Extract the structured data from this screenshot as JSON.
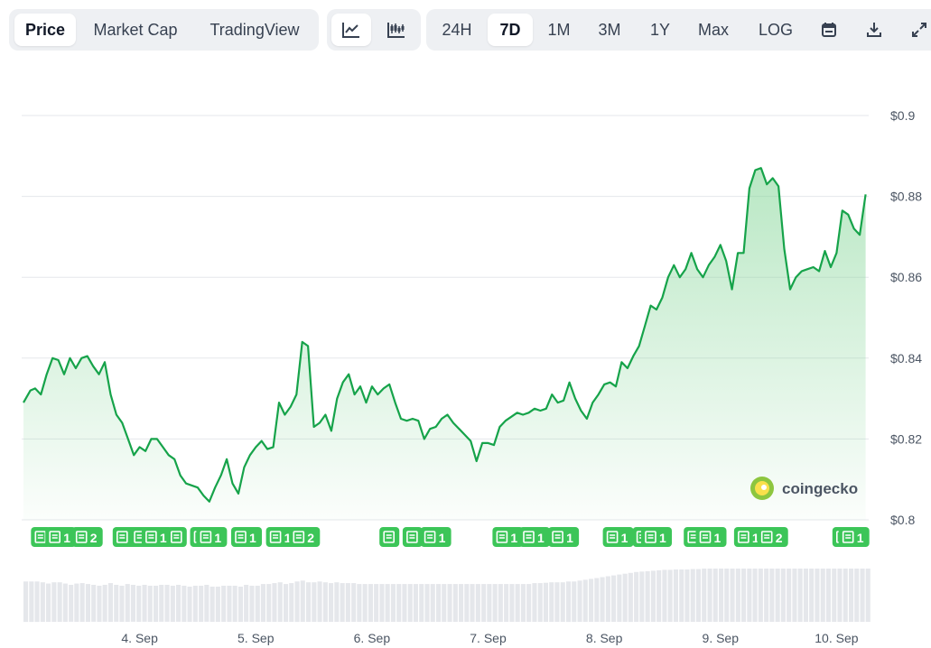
{
  "toolbar": {
    "metric_tabs": [
      {
        "label": "Price",
        "active": true
      },
      {
        "label": "Market Cap",
        "active": false
      },
      {
        "label": "TradingView",
        "active": false
      }
    ],
    "chart_style": [
      {
        "icon": "line-chart-icon",
        "active": true
      },
      {
        "icon": "candlestick-icon",
        "active": false
      }
    ],
    "ranges": [
      {
        "label": "24H",
        "active": false
      },
      {
        "label": "7D",
        "active": true
      },
      {
        "label": "1M",
        "active": false
      },
      {
        "label": "3M",
        "active": false
      },
      {
        "label": "1Y",
        "active": false
      },
      {
        "label": "Max",
        "active": false
      },
      {
        "label": "LOG",
        "active": false
      }
    ],
    "tools": [
      "calendar-icon",
      "download-icon",
      "expand-icon"
    ]
  },
  "watermark": "coingecko",
  "colors": {
    "line": "#16a34a",
    "area_top": "#bfe8c9",
    "badge": "#3cc558",
    "volume": "#e5e7eb",
    "grid": "#e5e7eb"
  },
  "chart_data": {
    "type": "area",
    "ylim": [
      0.8,
      0.9
    ],
    "yticks": [
      "$0.9",
      "$0.88",
      "$0.86",
      "$0.84",
      "$0.82",
      "$0.8"
    ],
    "ytick_values": [
      0.9,
      0.88,
      0.86,
      0.84,
      0.82,
      0.8
    ],
    "xlabels": [
      "4. Sep",
      "5. Sep",
      "6. Sep",
      "7. Sep",
      "8. Sep",
      "9. Sep",
      "10. Sep"
    ],
    "xlabel_days": [
      1,
      2,
      3,
      4,
      5,
      6,
      7
    ],
    "x_range_days": [
      0,
      7.3
    ],
    "price": [
      [
        0.0,
        0.829
      ],
      [
        0.06,
        0.832
      ],
      [
        0.1,
        0.8325
      ],
      [
        0.15,
        0.831
      ],
      [
        0.2,
        0.836
      ],
      [
        0.25,
        0.84
      ],
      [
        0.3,
        0.8395
      ],
      [
        0.35,
        0.836
      ],
      [
        0.4,
        0.84
      ],
      [
        0.45,
        0.8375
      ],
      [
        0.5,
        0.84
      ],
      [
        0.55,
        0.8405
      ],
      [
        0.6,
        0.838
      ],
      [
        0.65,
        0.836
      ],
      [
        0.7,
        0.839
      ],
      [
        0.75,
        0.831
      ],
      [
        0.8,
        0.826
      ],
      [
        0.85,
        0.824
      ],
      [
        0.9,
        0.82
      ],
      [
        0.95,
        0.816
      ],
      [
        1.0,
        0.818
      ],
      [
        1.05,
        0.817
      ],
      [
        1.1,
        0.82
      ],
      [
        1.15,
        0.82
      ],
      [
        1.2,
        0.818
      ],
      [
        1.25,
        0.816
      ],
      [
        1.3,
        0.815
      ],
      [
        1.35,
        0.811
      ],
      [
        1.4,
        0.809
      ],
      [
        1.45,
        0.8085
      ],
      [
        1.5,
        0.808
      ],
      [
        1.55,
        0.806
      ],
      [
        1.6,
        0.8045
      ],
      [
        1.65,
        0.808
      ],
      [
        1.7,
        0.811
      ],
      [
        1.75,
        0.815
      ],
      [
        1.8,
        0.809
      ],
      [
        1.85,
        0.8065
      ],
      [
        1.9,
        0.813
      ],
      [
        1.95,
        0.816
      ],
      [
        2.0,
        0.818
      ],
      [
        2.05,
        0.8195
      ],
      [
        2.1,
        0.8175
      ],
      [
        2.15,
        0.818
      ],
      [
        2.2,
        0.829
      ],
      [
        2.25,
        0.826
      ],
      [
        2.3,
        0.828
      ],
      [
        2.35,
        0.831
      ],
      [
        2.4,
        0.844
      ],
      [
        2.45,
        0.843
      ],
      [
        2.5,
        0.823
      ],
      [
        2.55,
        0.824
      ],
      [
        2.6,
        0.826
      ],
      [
        2.65,
        0.822
      ],
      [
        2.7,
        0.83
      ],
      [
        2.75,
        0.834
      ],
      [
        2.8,
        0.836
      ],
      [
        2.85,
        0.831
      ],
      [
        2.9,
        0.833
      ],
      [
        2.95,
        0.829
      ],
      [
        3.0,
        0.833
      ],
      [
        3.05,
        0.831
      ],
      [
        3.1,
        0.8325
      ],
      [
        3.15,
        0.8335
      ],
      [
        3.2,
        0.829
      ],
      [
        3.25,
        0.825
      ],
      [
        3.3,
        0.8245
      ],
      [
        3.35,
        0.825
      ],
      [
        3.4,
        0.8245
      ],
      [
        3.45,
        0.82
      ],
      [
        3.5,
        0.8225
      ],
      [
        3.55,
        0.823
      ],
      [
        3.6,
        0.825
      ],
      [
        3.65,
        0.826
      ],
      [
        3.7,
        0.824
      ],
      [
        3.75,
        0.8225
      ],
      [
        3.8,
        0.821
      ],
      [
        3.85,
        0.8195
      ],
      [
        3.9,
        0.8145
      ],
      [
        3.95,
        0.819
      ],
      [
        4.0,
        0.819
      ],
      [
        4.05,
        0.8185
      ],
      [
        4.1,
        0.823
      ],
      [
        4.15,
        0.8245
      ],
      [
        4.2,
        0.8255
      ],
      [
        4.25,
        0.8265
      ],
      [
        4.3,
        0.826
      ],
      [
        4.35,
        0.8265
      ],
      [
        4.4,
        0.8275
      ],
      [
        4.45,
        0.827
      ],
      [
        4.5,
        0.8275
      ],
      [
        4.55,
        0.831
      ],
      [
        4.6,
        0.829
      ],
      [
        4.65,
        0.8295
      ],
      [
        4.7,
        0.834
      ],
      [
        4.75,
        0.83
      ],
      [
        4.8,
        0.827
      ],
      [
        4.85,
        0.825
      ],
      [
        4.9,
        0.829
      ],
      [
        4.95,
        0.831
      ],
      [
        5.0,
        0.8335
      ],
      [
        5.05,
        0.834
      ],
      [
        5.1,
        0.833
      ],
      [
        5.15,
        0.839
      ],
      [
        5.2,
        0.8375
      ],
      [
        5.25,
        0.8405
      ],
      [
        5.3,
        0.843
      ],
      [
        5.35,
        0.848
      ],
      [
        5.4,
        0.853
      ],
      [
        5.45,
        0.852
      ],
      [
        5.5,
        0.855
      ],
      [
        5.55,
        0.86
      ],
      [
        5.6,
        0.863
      ],
      [
        5.65,
        0.86
      ],
      [
        5.7,
        0.862
      ],
      [
        5.75,
        0.866
      ],
      [
        5.8,
        0.862
      ],
      [
        5.85,
        0.86
      ],
      [
        5.9,
        0.863
      ],
      [
        5.95,
        0.865
      ],
      [
        6.0,
        0.868
      ],
      [
        6.05,
        0.864
      ],
      [
        6.1,
        0.857
      ],
      [
        6.15,
        0.866
      ],
      [
        6.2,
        0.866
      ],
      [
        6.25,
        0.882
      ],
      [
        6.3,
        0.8865
      ],
      [
        6.35,
        0.887
      ],
      [
        6.4,
        0.883
      ],
      [
        6.45,
        0.8845
      ],
      [
        6.5,
        0.8825
      ],
      [
        6.55,
        0.867
      ],
      [
        6.6,
        0.857
      ],
      [
        6.65,
        0.86
      ],
      [
        6.7,
        0.8615
      ],
      [
        6.75,
        0.862
      ],
      [
        6.8,
        0.8625
      ],
      [
        6.85,
        0.8615
      ],
      [
        6.9,
        0.8665
      ],
      [
        6.95,
        0.8625
      ],
      [
        7.0,
        0.866
      ],
      [
        7.05,
        0.8765
      ],
      [
        7.1,
        0.8755
      ],
      [
        7.15,
        0.872
      ],
      [
        7.2,
        0.8705
      ],
      [
        7.25,
        0.8805
      ]
    ],
    "volume_relative": [
      0.9,
      0.9,
      0.9,
      0.88,
      0.85,
      0.88,
      0.88,
      0.85,
      0.82,
      0.85,
      0.86,
      0.84,
      0.82,
      0.8,
      0.82,
      0.86,
      0.82,
      0.8,
      0.84,
      0.82,
      0.8,
      0.82,
      0.8,
      0.8,
      0.82,
      0.82,
      0.8,
      0.82,
      0.8,
      0.78,
      0.8,
      0.8,
      0.82,
      0.78,
      0.78,
      0.8,
      0.8,
      0.8,
      0.78,
      0.82,
      0.8,
      0.8,
      0.84,
      0.84,
      0.86,
      0.88,
      0.84,
      0.86,
      0.9,
      0.92,
      0.88,
      0.88,
      0.9,
      0.88,
      0.86,
      0.88,
      0.86,
      0.86,
      0.86,
      0.84,
      0.84,
      0.84,
      0.84,
      0.84,
      0.84,
      0.84,
      0.84,
      0.84,
      0.84,
      0.84,
      0.84,
      0.84,
      0.84,
      0.84,
      0.84,
      0.84,
      0.84,
      0.84,
      0.84,
      0.84,
      0.84,
      0.84,
      0.84,
      0.84,
      0.84,
      0.84,
      0.84,
      0.84,
      0.84,
      0.84,
      0.86,
      0.86,
      0.87,
      0.88,
      0.88,
      0.88,
      0.9,
      0.9,
      0.92,
      0.94,
      0.96,
      0.98,
      1.0,
      1.02,
      1.04,
      1.06,
      1.08,
      1.1,
      1.12,
      1.13,
      1.14,
      1.15,
      1.16,
      1.17,
      1.17,
      1.18,
      1.18,
      1.18,
      1.19,
      1.19,
      1.2,
      1.2,
      1.2,
      1.2,
      1.2,
      1.2,
      1.2,
      1.2,
      1.2,
      1.2,
      1.2,
      1.2,
      1.2,
      1.2,
      1.2,
      1.2,
      1.2,
      1.2,
      1.2,
      1.2,
      1.2,
      1.2,
      1.2,
      1.2,
      1.2,
      1.2,
      1.2,
      1.2,
      1.2,
      1.2
    ],
    "news_badges": [
      {
        "x": 0.15,
        "count": "",
        "tail": ""
      },
      {
        "x": 0.32,
        "count": "",
        "tail": "1"
      },
      {
        "x": 0.55,
        "count": "2",
        "tail": ""
      },
      {
        "x": 0.9,
        "count": "",
        "tail": "1"
      },
      {
        "x": 1.05,
        "count": "",
        "tail": "1"
      },
      {
        "x": 1.15,
        "count": "",
        "tail": "1"
      },
      {
        "x": 1.32,
        "count": "",
        "tail": ""
      },
      {
        "x": 1.52,
        "count": "",
        "tail": ""
      },
      {
        "x": 1.62,
        "count": "1",
        "tail": ""
      },
      {
        "x": 1.92,
        "count": "1",
        "tail": ""
      },
      {
        "x": 2.22,
        "count": "",
        "tail": "1"
      },
      {
        "x": 2.42,
        "count": "2",
        "tail": ""
      },
      {
        "x": 3.15,
        "count": "",
        "tail": ""
      },
      {
        "x": 3.35,
        "count": "",
        "tail": ""
      },
      {
        "x": 3.55,
        "count": "1",
        "tail": ""
      },
      {
        "x": 4.17,
        "count": "1",
        "tail": ""
      },
      {
        "x": 4.4,
        "count": "1",
        "tail": ""
      },
      {
        "x": 4.65,
        "count": "1",
        "tail": ""
      },
      {
        "x": 5.12,
        "count": "",
        "tail": "1"
      },
      {
        "x": 5.33,
        "count": "",
        "tail": ""
      },
      {
        "x": 5.45,
        "count": "1",
        "tail": ""
      },
      {
        "x": 5.77,
        "count": "",
        "tail": ""
      },
      {
        "x": 5.92,
        "count": "1",
        "tail": ""
      },
      {
        "x": 6.25,
        "count": "1",
        "tail": ""
      },
      {
        "x": 6.45,
        "count": "2",
        "tail": ""
      },
      {
        "x": 7.05,
        "count": "",
        "tail": ""
      },
      {
        "x": 7.15,
        "count": "1",
        "tail": ""
      }
    ]
  }
}
